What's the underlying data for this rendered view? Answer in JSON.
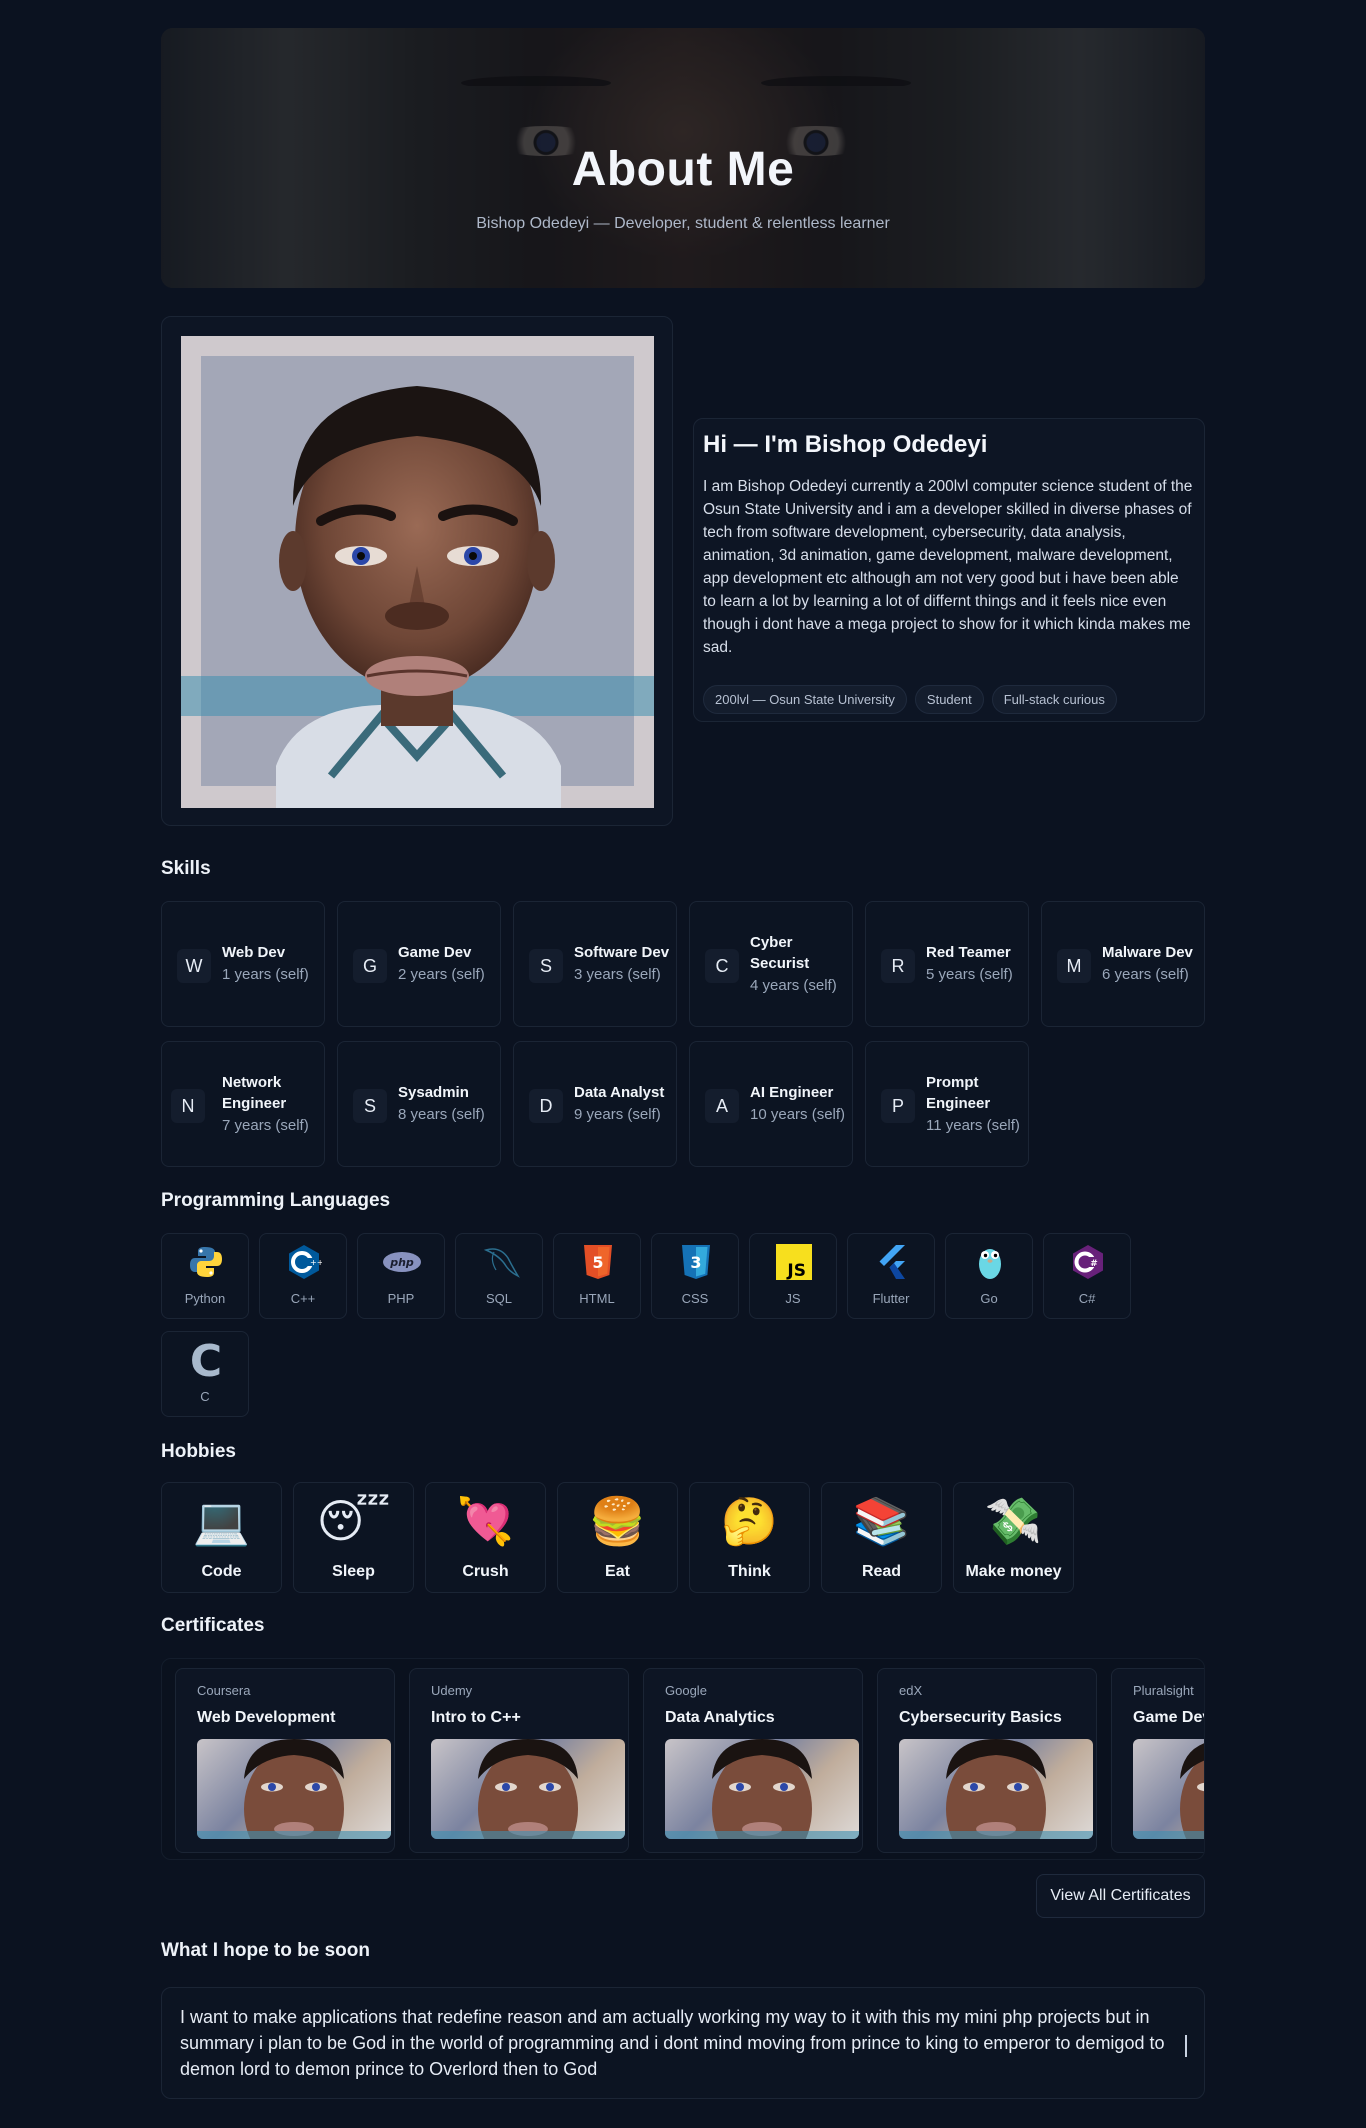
{
  "hero": {
    "title": "About Me",
    "subtitle": "Bishop Odedeyi — Developer, student & relentless learner"
  },
  "intro": {
    "heading": "Hi — I'm Bishop Odedeyi",
    "bio": "I am Bishop Odedeyi currently a 200lvl computer science student of the Osun State University and i am a developer skilled in diverse phases of tech from software development, cybersecurity, data analysis, animation, 3d animation, game development, malware development, app development etc although am not very good but i have been able to learn a lot by learning a lot of differnt things and it feels nice even though i dont have a mega project to show for it which kinda makes me sad.",
    "tags": [
      "200lvl — Osun State University",
      "Student",
      "Full-stack curious"
    ]
  },
  "skills": {
    "title": "Skills",
    "items": [
      {
        "letter": "W",
        "name": "Web Dev",
        "years": "1 years (self)"
      },
      {
        "letter": "G",
        "name": "Game Dev",
        "years": "2 years (self)"
      },
      {
        "letter": "S",
        "name": "Software Dev",
        "years": "3 years (self)"
      },
      {
        "letter": "C",
        "name": "Cyber Securist",
        "years": "4 years (self)"
      },
      {
        "letter": "R",
        "name": "Red Teamer",
        "years": "5 years (self)"
      },
      {
        "letter": "M",
        "name": "Malware Dev",
        "years": "6 years (self)"
      },
      {
        "letter": "N",
        "name": "Network Engineer",
        "years": "7 years (self)"
      },
      {
        "letter": "S",
        "name": "Sysadmin",
        "years": "8 years (self)"
      },
      {
        "letter": "D",
        "name": "Data Analyst",
        "years": "9 years (self)"
      },
      {
        "letter": "A",
        "name": "AI Engineer",
        "years": "10 years (self)"
      },
      {
        "letter": "P",
        "name": "Prompt Engineer",
        "years": "11 years (self)"
      }
    ]
  },
  "languages": {
    "title": "Programming Languages",
    "items": [
      {
        "label": "Python",
        "icon": "python-icon"
      },
      {
        "label": "C++",
        "icon": "cpp-icon"
      },
      {
        "label": "PHP",
        "icon": "php-icon"
      },
      {
        "label": "SQL",
        "icon": "sql-icon"
      },
      {
        "label": "HTML",
        "icon": "html-icon"
      },
      {
        "label": "CSS",
        "icon": "css-icon"
      },
      {
        "label": "JS",
        "icon": "js-icon"
      },
      {
        "label": "Flutter",
        "icon": "flutter-icon"
      },
      {
        "label": "Go",
        "icon": "go-icon"
      },
      {
        "label": "C#",
        "icon": "csharp-icon"
      },
      {
        "label": "C",
        "icon": "c-icon"
      }
    ]
  },
  "hobbies": {
    "title": "Hobbies",
    "items": [
      {
        "emoji": "💻",
        "label": "Code"
      },
      {
        "emoji": "😴",
        "label": "Sleep"
      },
      {
        "emoji": "💘",
        "label": "Crush"
      },
      {
        "emoji": "🍔",
        "label": "Eat"
      },
      {
        "emoji": "🤔",
        "label": "Think"
      },
      {
        "emoji": "📚",
        "label": "Read"
      },
      {
        "emoji": "💸",
        "label": "Make money"
      }
    ]
  },
  "certificates": {
    "title": "Certificates",
    "items": [
      {
        "provider": "Coursera",
        "title": "Web Development"
      },
      {
        "provider": "Udemy",
        "title": "Intro to C++"
      },
      {
        "provider": "Google",
        "title": "Data Analytics"
      },
      {
        "provider": "edX",
        "title": "Cybersecurity Basics"
      },
      {
        "provider": "Pluralsight",
        "title": "Game Dev I"
      }
    ],
    "view_all": "View All Certificates"
  },
  "hope": {
    "title": "What I hope to be soon",
    "text": "I want to make applications that redefine reason and am actually working my way to it with this my mini php projects but in summary i plan to be God in the world of programming and i dont mind moving from prince to king to emperor to demigod to demon lord to demon prince to Overlord then to God"
  },
  "colors": {
    "background": "#0b1220",
    "card": "#0c1422",
    "border": "#1b2535",
    "muted_text": "#9aa7ba"
  }
}
